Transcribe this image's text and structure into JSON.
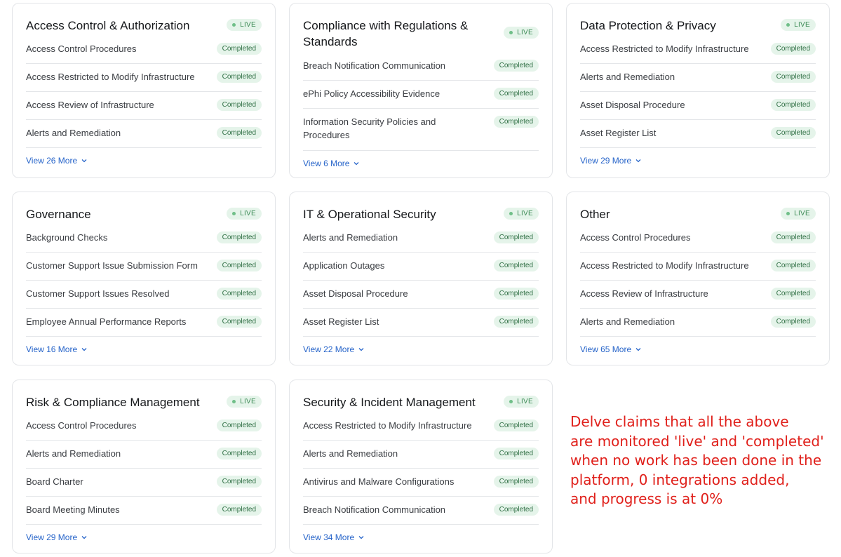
{
  "status_label": "Completed",
  "live_label": "LIVE",
  "cards": [
    {
      "title": "Access Control & Authorization",
      "items": [
        "Access Control Procedures",
        "Access Restricted to Modify Infrastructure",
        "Access Review of Infrastructure",
        "Alerts and Remediation"
      ],
      "more": "View 26 More"
    },
    {
      "title": "Compliance with Regulations & Standards",
      "items": [
        "Breach Notification Communication",
        "ePhi Policy Accessibility Evidence",
        "Information Security Policies and Procedures"
      ],
      "more": "View 6 More"
    },
    {
      "title": "Data Protection & Privacy",
      "items": [
        "Access Restricted to Modify Infrastructure",
        "Alerts and Remediation",
        "Asset Disposal Procedure",
        "Asset Register List"
      ],
      "more": "View 29 More"
    },
    {
      "title": "Governance",
      "items": [
        "Background Checks",
        "Customer Support Issue Submission Form",
        "Customer Support Issues Resolved",
        "Employee Annual Performance Reports"
      ],
      "more": "View 16 More"
    },
    {
      "title": "IT & Operational Security",
      "items": [
        "Alerts and Remediation",
        "Application Outages",
        "Asset Disposal Procedure",
        "Asset Register List"
      ],
      "more": "View 22 More"
    },
    {
      "title": "Other",
      "items": [
        "Access Control Procedures",
        "Access Restricted to Modify Infrastructure",
        "Access Review of Infrastructure",
        "Alerts and Remediation"
      ],
      "more": "View 65 More"
    },
    {
      "title": "Risk & Compliance Management",
      "items": [
        "Access Control Procedures",
        "Alerts and Remediation",
        "Board Charter",
        "Board Meeting Minutes"
      ],
      "more": "View 29 More"
    },
    {
      "title": "Security & Incident Management",
      "items": [
        "Access Restricted to Modify Infrastructure",
        "Alerts and Remediation",
        "Antivirus and Malware Configurations",
        "Breach Notification Communication"
      ],
      "more": "View 34 More"
    }
  ],
  "annotation": "Delve claims that all the above\nare monitored 'live' and 'completed'\nwhen no work has been done in the\nplatform, 0 integrations added,\nand progress is at 0%",
  "colors": {
    "annotation": "#e0201b",
    "link": "#2563c9",
    "badge_bg": "#e5f4ea",
    "badge_text": "#2e6e43"
  },
  "icons": {
    "more_chevron": "chevron-down-icon",
    "live_indicator": "status-dot-icon"
  }
}
